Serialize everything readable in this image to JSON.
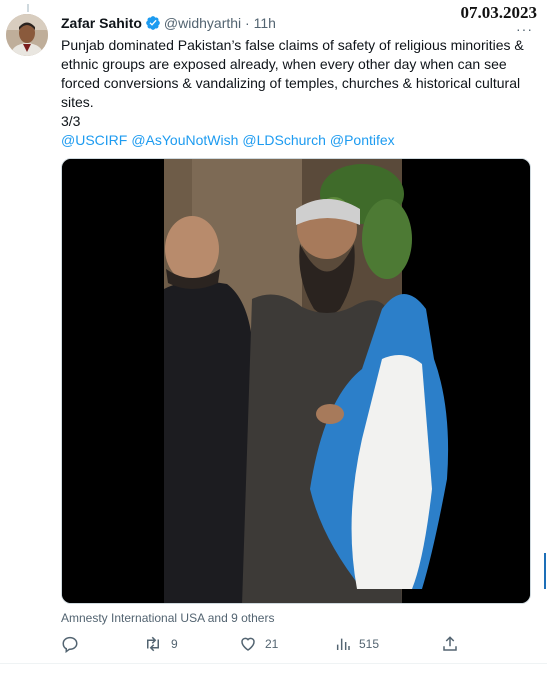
{
  "date_stamp": "07.03.2023",
  "tweet": {
    "author_name": "Zafar Sahito",
    "handle": "@widhyarthi",
    "separator": "·",
    "time": "11h",
    "text_body": "Punjab dominated Pakistan’s false claims of safety of religious minorities & ethnic groups are exposed already, when every other day when can see forced conversions & vandalizing of temples, churches & historical cultural sites.",
    "thread_counter": "3/3",
    "mentions": [
      "@USCIRF",
      "@AsYouNotWish",
      "@LDSchurch",
      "@Pontifex"
    ],
    "liked_by": "Amnesty International USA and 9 others",
    "stats": {
      "retweets": "9",
      "likes": "21",
      "views": "515"
    }
  },
  "icons": {
    "verified": "verified-badge-icon",
    "more": "more-options-icon",
    "reply": "reply-icon",
    "retweet": "retweet-icon",
    "like": "heart-icon",
    "views": "views-chart-icon",
    "share": "share-icon"
  },
  "colors": {
    "accent": "#1d9bf0",
    "secondary_text": "#536471",
    "primary_text": "#0f1419"
  }
}
